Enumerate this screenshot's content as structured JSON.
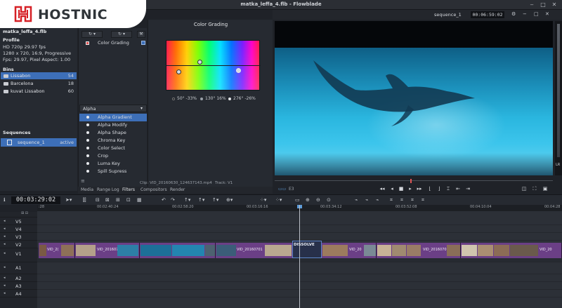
{
  "window": {
    "title": "matka_leffa_4.flb - Flowblade"
  },
  "logo": {
    "text": "HOSTNIC"
  },
  "project": {
    "name": "matka_leffa_4.flb",
    "profile_heading": "Profile",
    "profile_lines": [
      "HD 720p 29.97 fps",
      "1280 x 720, 16:9, Progressive",
      "Fps: 29.97, Pixel Aspect: 1.00"
    ]
  },
  "bins": {
    "heading": "Bins",
    "items": [
      {
        "label": "Lissabon",
        "count": "54"
      },
      {
        "label": "Barcelona",
        "count": "18"
      },
      {
        "label": "kuvat Lissabon",
        "count": "60"
      }
    ]
  },
  "sequences": {
    "heading": "Sequences",
    "items": [
      {
        "label": "sequence_1",
        "status": "active"
      }
    ]
  },
  "filters": {
    "applied": [
      {
        "label": "Color Grading"
      }
    ],
    "group_select": "Alpha",
    "list": [
      "Alpha Gradient",
      "Alpha Modify",
      "Alpha Shape",
      "Chroma Key",
      "Color Select",
      "Crop",
      "Luma Key",
      "Spill Supress"
    ],
    "selected_index": 0
  },
  "grading": {
    "title": "Color Grading",
    "legend": [
      "50° -33%",
      "130° 16%",
      "276° -26%"
    ]
  },
  "clip_info": {
    "clip": "Clip: VID_20160630_124637143.mp4",
    "track": "Track: V1"
  },
  "tabs": [
    "Media",
    "Range Log",
    "Filters",
    "Compositors",
    "Render"
  ],
  "active_tab": "Filters",
  "monitor": {
    "sequence_name": "sequence_1",
    "timecode": "00:06:59:02",
    "mode_label": "E3",
    "lr_label": "LR"
  },
  "timeline": {
    "timecode": "00:03:29:02",
    "ruler": [
      ":28",
      "00:02:40:24",
      "00:02:58:20",
      "00:03:16:16",
      "00:03:34:12",
      "00:03:52:08",
      "00:04:10:04",
      "00:04:28"
    ],
    "tracks": [
      "V5",
      "V4",
      "V3",
      "V2",
      "V1",
      "A1",
      "A2",
      "A3",
      "A4"
    ],
    "clips": [
      "VID_2(",
      "VID_20160701",
      "VID_20160701",
      "VID_20",
      "VID_20160701",
      "VID_20"
    ],
    "transition": "DISSOLVE"
  },
  "colors": {
    "accent": "#3d6fb8",
    "clip": "#6b3f86",
    "background": "#1f2228"
  }
}
